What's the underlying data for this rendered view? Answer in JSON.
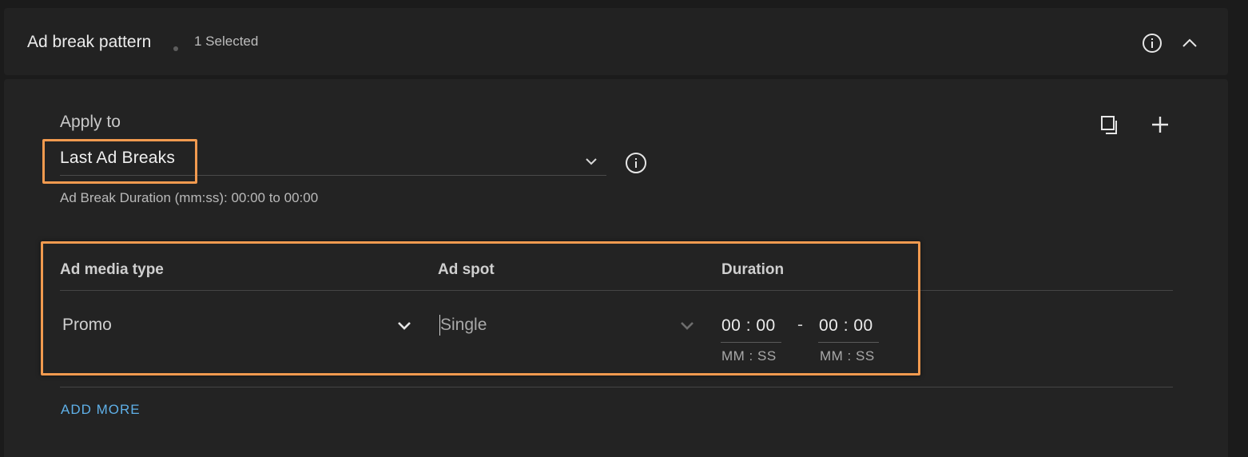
{
  "header": {
    "title": "Ad break pattern",
    "selected_count": "1 Selected",
    "info_icon": "info-circle-icon",
    "collapse_icon": "chevron-up-icon"
  },
  "apply_to": {
    "label": "Apply to",
    "value": "Last Ad Breaks",
    "dropdown_icon": "chevron-down-icon",
    "info_icon": "info-circle-icon",
    "duration_note": "Ad Break Duration (mm:ss): 00:00 to 00:00"
  },
  "toolbar": {
    "copy_icon": "copy-icon",
    "add_icon": "plus-icon"
  },
  "table": {
    "columns": [
      "Ad media type",
      "Ad spot",
      "Duration"
    ],
    "rows": [
      {
        "media_type": "Promo",
        "ad_spot": "Single",
        "duration_from": "00 : 00",
        "duration_to": "00 : 00",
        "duration_from_hint": "MM : SS",
        "duration_to_hint": "MM : SS",
        "separator": "-"
      }
    ]
  },
  "add_more_label": "ADD MORE",
  "colors": {
    "background": "#1b1b1b",
    "panel": "#232323",
    "highlight": "#f19a4f",
    "link": "#5fb0e8"
  }
}
